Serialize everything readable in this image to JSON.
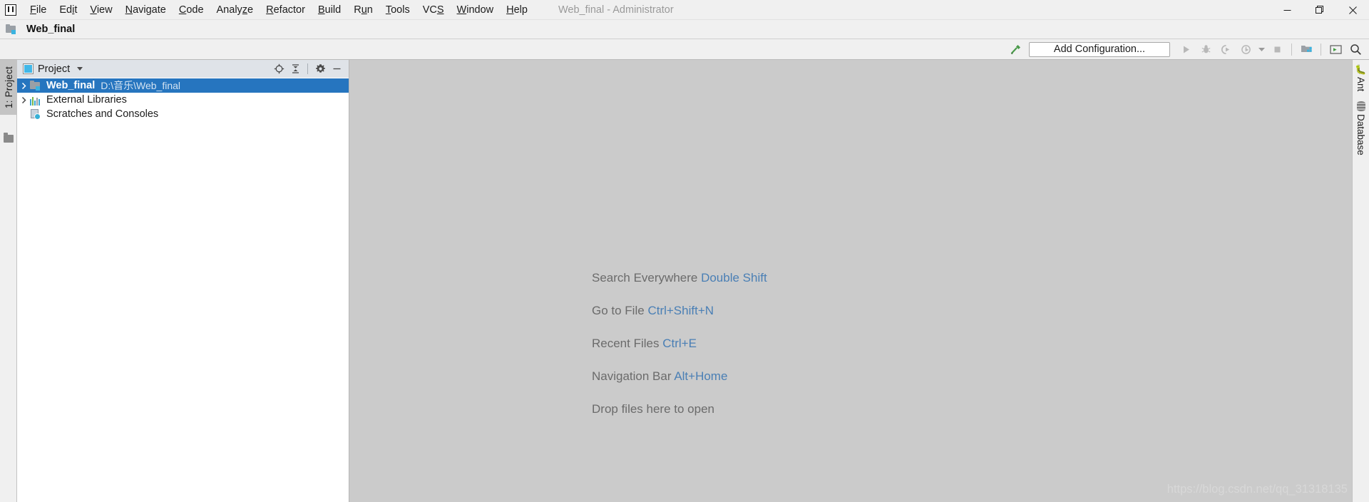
{
  "window": {
    "title": "Web_final - Administrator",
    "app_icon": "intellij-idea-logo",
    "controls": {
      "minimize": "minimize-icon",
      "maximize": "maximize-icon",
      "close": "close-icon"
    }
  },
  "menu": {
    "items": [
      {
        "label": "File",
        "mnemonic": "F"
      },
      {
        "label": "Edit",
        "mnemonic": "E"
      },
      {
        "label": "View",
        "mnemonic": "V"
      },
      {
        "label": "Navigate",
        "mnemonic": "N"
      },
      {
        "label": "Code",
        "mnemonic": "C"
      },
      {
        "label": "Analyze",
        "mnemonic": "z"
      },
      {
        "label": "Refactor",
        "mnemonic": "R"
      },
      {
        "label": "Build",
        "mnemonic": "B"
      },
      {
        "label": "Run",
        "mnemonic": "u"
      },
      {
        "label": "Tools",
        "mnemonic": "T"
      },
      {
        "label": "VCS",
        "mnemonic": "S"
      },
      {
        "label": "Window",
        "mnemonic": "W"
      },
      {
        "label": "Help",
        "mnemonic": "H"
      }
    ]
  },
  "navbar": {
    "project_name": "Web_final",
    "icon": "module-folder-icon"
  },
  "toolbar": {
    "build_icon": "hammer-icon",
    "add_configuration_label": "Add Configuration...",
    "run_icon": "run-play-icon",
    "debug_icon": "debug-bug-icon",
    "run_coverage_icon": "run-with-coverage-icon",
    "profile_icon": "profile-icon",
    "profile_dropdown_icon": "chevron-down-icon",
    "stop_icon": "stop-square-icon",
    "project_structure_icon": "project-structure-icon",
    "terminal_icon": "terminal-icon",
    "search_icon": "search-icon"
  },
  "left_strip": {
    "project_tab_label": "1: Project",
    "favorites_icon": "folder-icon"
  },
  "project_panel": {
    "title": "Project",
    "title_icon": "project-view-icon",
    "dropdown_icon": "chevron-down-icon",
    "actions": [
      {
        "name": "scroll-from-source-icon",
        "label": "Select Opened File"
      },
      {
        "name": "collapse-all-icon",
        "label": "Collapse All"
      },
      {
        "name": "gear-icon",
        "label": "Settings"
      },
      {
        "name": "minimize-icon",
        "label": "Hide"
      }
    ],
    "tree": [
      {
        "label": "Web_final",
        "path": "D:\\音乐\\Web_final",
        "icon": "module-folder-icon",
        "expandable": true,
        "expanded": false,
        "selected": true,
        "indent": 0
      },
      {
        "label": "External Libraries",
        "path": "",
        "icon": "external-libraries-icon",
        "expandable": true,
        "expanded": false,
        "selected": false,
        "indent": 0
      },
      {
        "label": "Scratches and Consoles",
        "path": "",
        "icon": "scratches-consoles-icon",
        "expandable": false,
        "expanded": false,
        "selected": false,
        "indent": 0
      }
    ]
  },
  "editor": {
    "hints": [
      {
        "action": "Search Everywhere",
        "shortcut": "Double Shift"
      },
      {
        "action": "Go to File",
        "shortcut": "Ctrl+Shift+N"
      },
      {
        "action": "Recent Files",
        "shortcut": "Ctrl+E"
      },
      {
        "action": "Navigation Bar",
        "shortcut": "Alt+Home"
      },
      {
        "action": "Drop files here to open",
        "shortcut": ""
      }
    ],
    "watermark": "https://blog.csdn.net/qq_31318135"
  },
  "right_strip": {
    "tabs": [
      {
        "label": "Ant",
        "icon": "ant-icon"
      },
      {
        "label": "Database",
        "icon": "database-icon"
      }
    ]
  },
  "colors": {
    "accent_selection": "#2675bf",
    "hint_key": "#4a7fb5",
    "editor_bg": "#cbcbcb",
    "chrome_bg": "#f0f0f0",
    "panel_header_bg": "#dfe3e8"
  }
}
